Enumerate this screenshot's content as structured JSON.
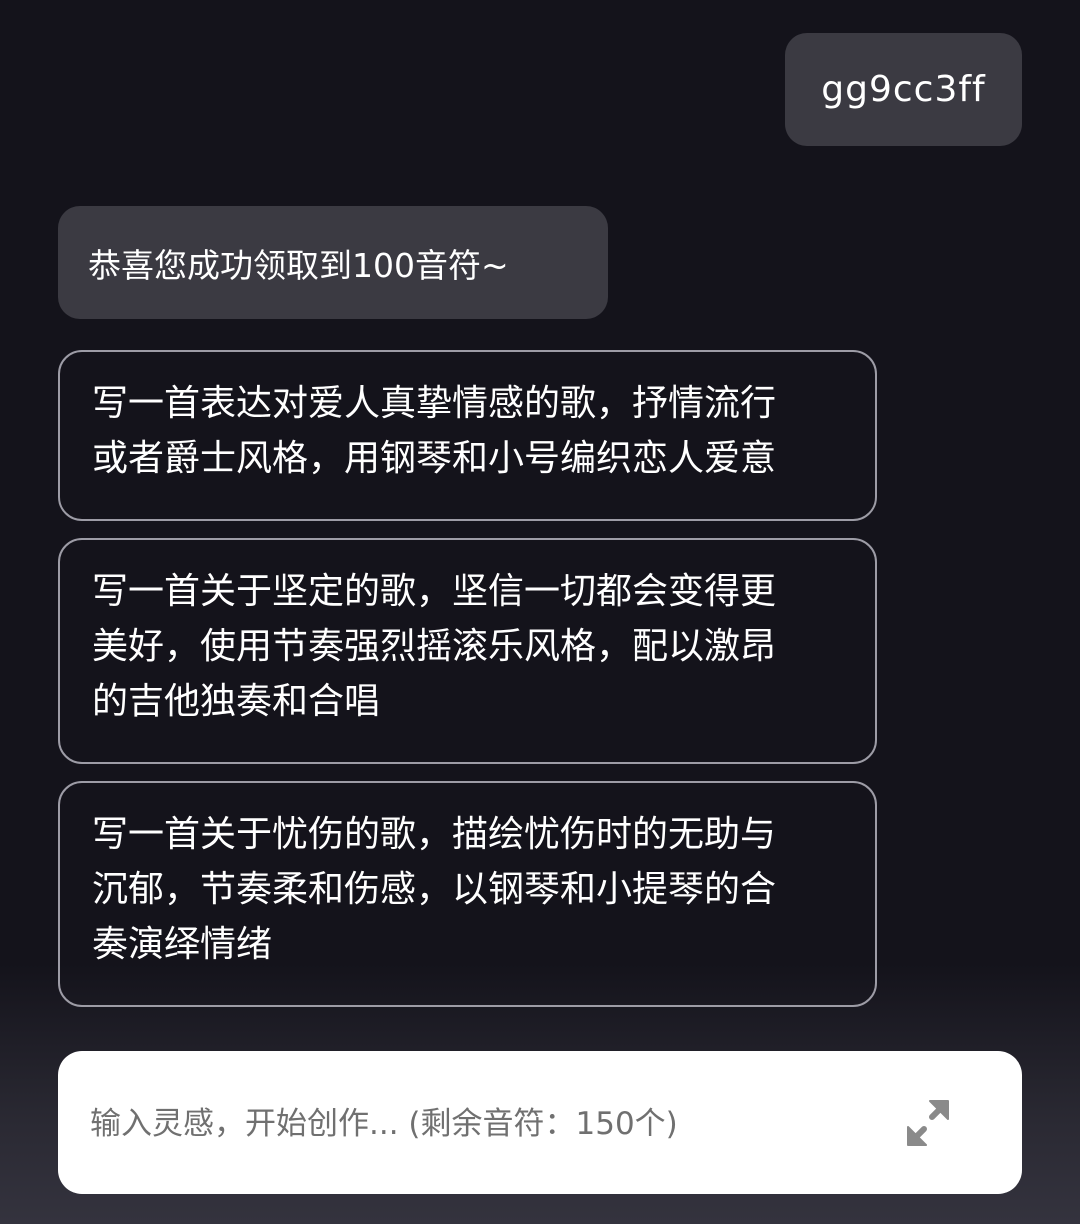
{
  "chat": {
    "user_message": "gg9cc3ff",
    "bot_message": "恭喜您成功领取到100音符~",
    "suggestions": [
      {
        "line1": "写一首表达对爱人真挚情感的歌，抒情流行",
        "line2": "或者爵士风格，用钢琴和小号编织恋人爱意",
        "line3": ""
      },
      {
        "line1": "写一首关于坚定的歌，坚信一切都会变得更",
        "line2": "美好，使用节奏强烈摇滚乐风格，配以激昂",
        "line3": "的吉他独奏和合唱"
      },
      {
        "line1": "写一首关于忧伤的歌，描绘忧伤时的无助与",
        "line2": "沉郁，节奏柔和伤感，以钢琴和小提琴的合",
        "line3": "奏演绎情绪"
      }
    ]
  },
  "composer": {
    "placeholder": "输入灵感，开始创作... (剩余音符：150个)",
    "value": "",
    "expand_icon": "expand-arrows-icon"
  },
  "colors": {
    "background": "#14131b",
    "bubble": "#3b3a42",
    "card_border": "#9d9ca6",
    "input_bg": "#ffffff",
    "icon": "#8a8a8a"
  }
}
